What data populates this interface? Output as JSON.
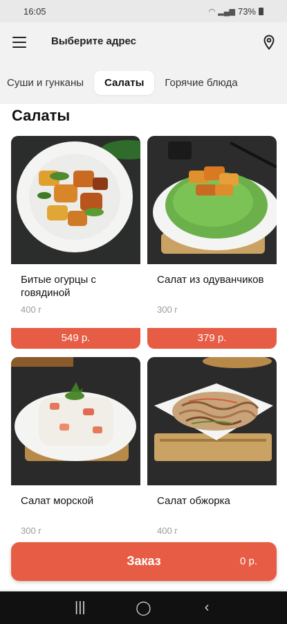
{
  "status": {
    "time": "16:05",
    "battery": "73%"
  },
  "header": {
    "address_label": "Выберите адрес"
  },
  "tabs": [
    {
      "label": "Суши и гунканы",
      "active": false
    },
    {
      "label": "Салаты",
      "active": true
    },
    {
      "label": "Горячие блюда",
      "active": false
    }
  ],
  "section": {
    "title": "Салаты"
  },
  "products": [
    {
      "name": "Битые огурцы с говядиной",
      "weight": "400 г",
      "price": "549 р."
    },
    {
      "name": "Салат из одуванчиков",
      "weight": "300 г",
      "price": "379 р."
    },
    {
      "name": "Салат морской",
      "weight": "300 г",
      "price": ""
    },
    {
      "name": "Салат обжорка",
      "weight": "400 г",
      "price": ""
    }
  ],
  "order": {
    "label": "Заказ",
    "total": "0 р."
  },
  "colors": {
    "accent": "#e65c45",
    "background": "#f2f2f2"
  },
  "icons": {
    "menu": "menu-icon",
    "location": "location-pin-icon"
  }
}
